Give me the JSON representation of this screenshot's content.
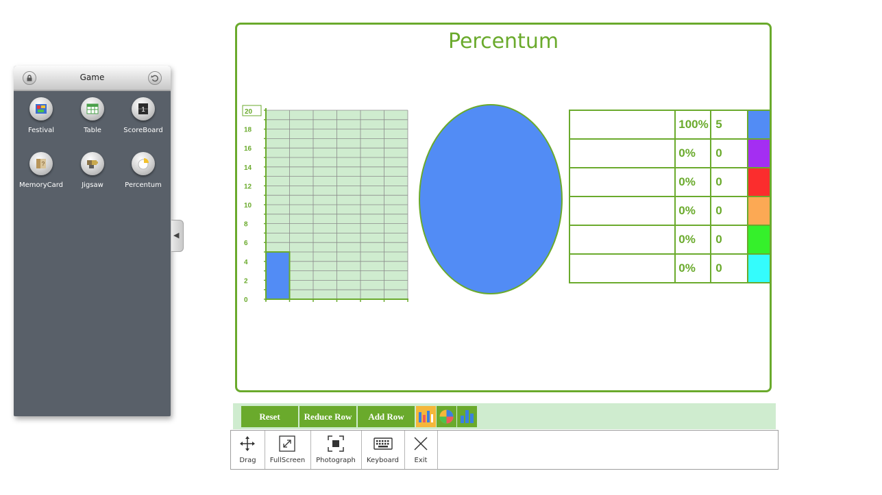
{
  "panel": {
    "title": "Game",
    "apps": [
      {
        "label": "Festival",
        "icon": "festival-icon"
      },
      {
        "label": "Table",
        "icon": "table-icon"
      },
      {
        "label": "ScoreBoard",
        "icon": "scoreboard-icon"
      },
      {
        "label": "MemoryCard",
        "icon": "memory-card-icon"
      },
      {
        "label": "Jigsaw",
        "icon": "jigsaw-icon"
      },
      {
        "label": "Percentum",
        "icon": "percentum-icon"
      }
    ]
  },
  "board": {
    "title": "Percentum",
    "rows": [
      {
        "percent": "100%",
        "count": "5",
        "color": "#528cf5"
      },
      {
        "percent": "0%",
        "count": "0",
        "color": "#a42ef2"
      },
      {
        "percent": "0%",
        "count": "0",
        "color": "#fb2d2d"
      },
      {
        "percent": "0%",
        "count": "0",
        "color": "#fca954"
      },
      {
        "percent": "0%",
        "count": "0",
        "color": "#35f02b"
      },
      {
        "percent": "0%",
        "count": "0",
        "color": "#34fcfc"
      }
    ]
  },
  "chart_data": [
    {
      "type": "bar",
      "categories": [
        "",
        "",
        "",
        "",
        "",
        ""
      ],
      "values": [
        5,
        0,
        0,
        0,
        0,
        0
      ],
      "colors": [
        "#528cf5",
        "#a42ef2",
        "#fb2d2d",
        "#fca954",
        "#35f02b",
        "#34fcfc"
      ],
      "ylim": [
        0,
        20
      ],
      "y_ticks": [
        "0",
        "2",
        "4",
        "6",
        "8",
        "10",
        "12",
        "14",
        "16",
        "18"
      ],
      "y_max_input": "20",
      "grid": true
    },
    {
      "type": "pie",
      "values": [
        100,
        0,
        0,
        0,
        0,
        0
      ],
      "colors": [
        "#528cf5",
        "#a42ef2",
        "#fb2d2d",
        "#fca954",
        "#35f02b",
        "#34fcfc"
      ]
    }
  ],
  "toolbar": {
    "reset_label": "Reset",
    "reduce_row_label": "Reduce Row",
    "add_row_label": "Add Row",
    "icons": [
      "bar-chart-icon",
      "pie-chart-icon",
      "column-chart-icon"
    ],
    "colors": {
      "accent": "#6aaa2c",
      "background": "#cfeccf",
      "selected": "#f4b73a"
    }
  },
  "bottom": {
    "items": [
      {
        "label": "Drag",
        "icon": "drag-icon"
      },
      {
        "label": "FullScreen",
        "icon": "fullscreen-icon"
      },
      {
        "label": "Photograph",
        "icon": "photograph-icon"
      },
      {
        "label": "Keyboard",
        "icon": "keyboard-icon"
      },
      {
        "label": "Exit",
        "icon": "exit-icon"
      }
    ]
  }
}
